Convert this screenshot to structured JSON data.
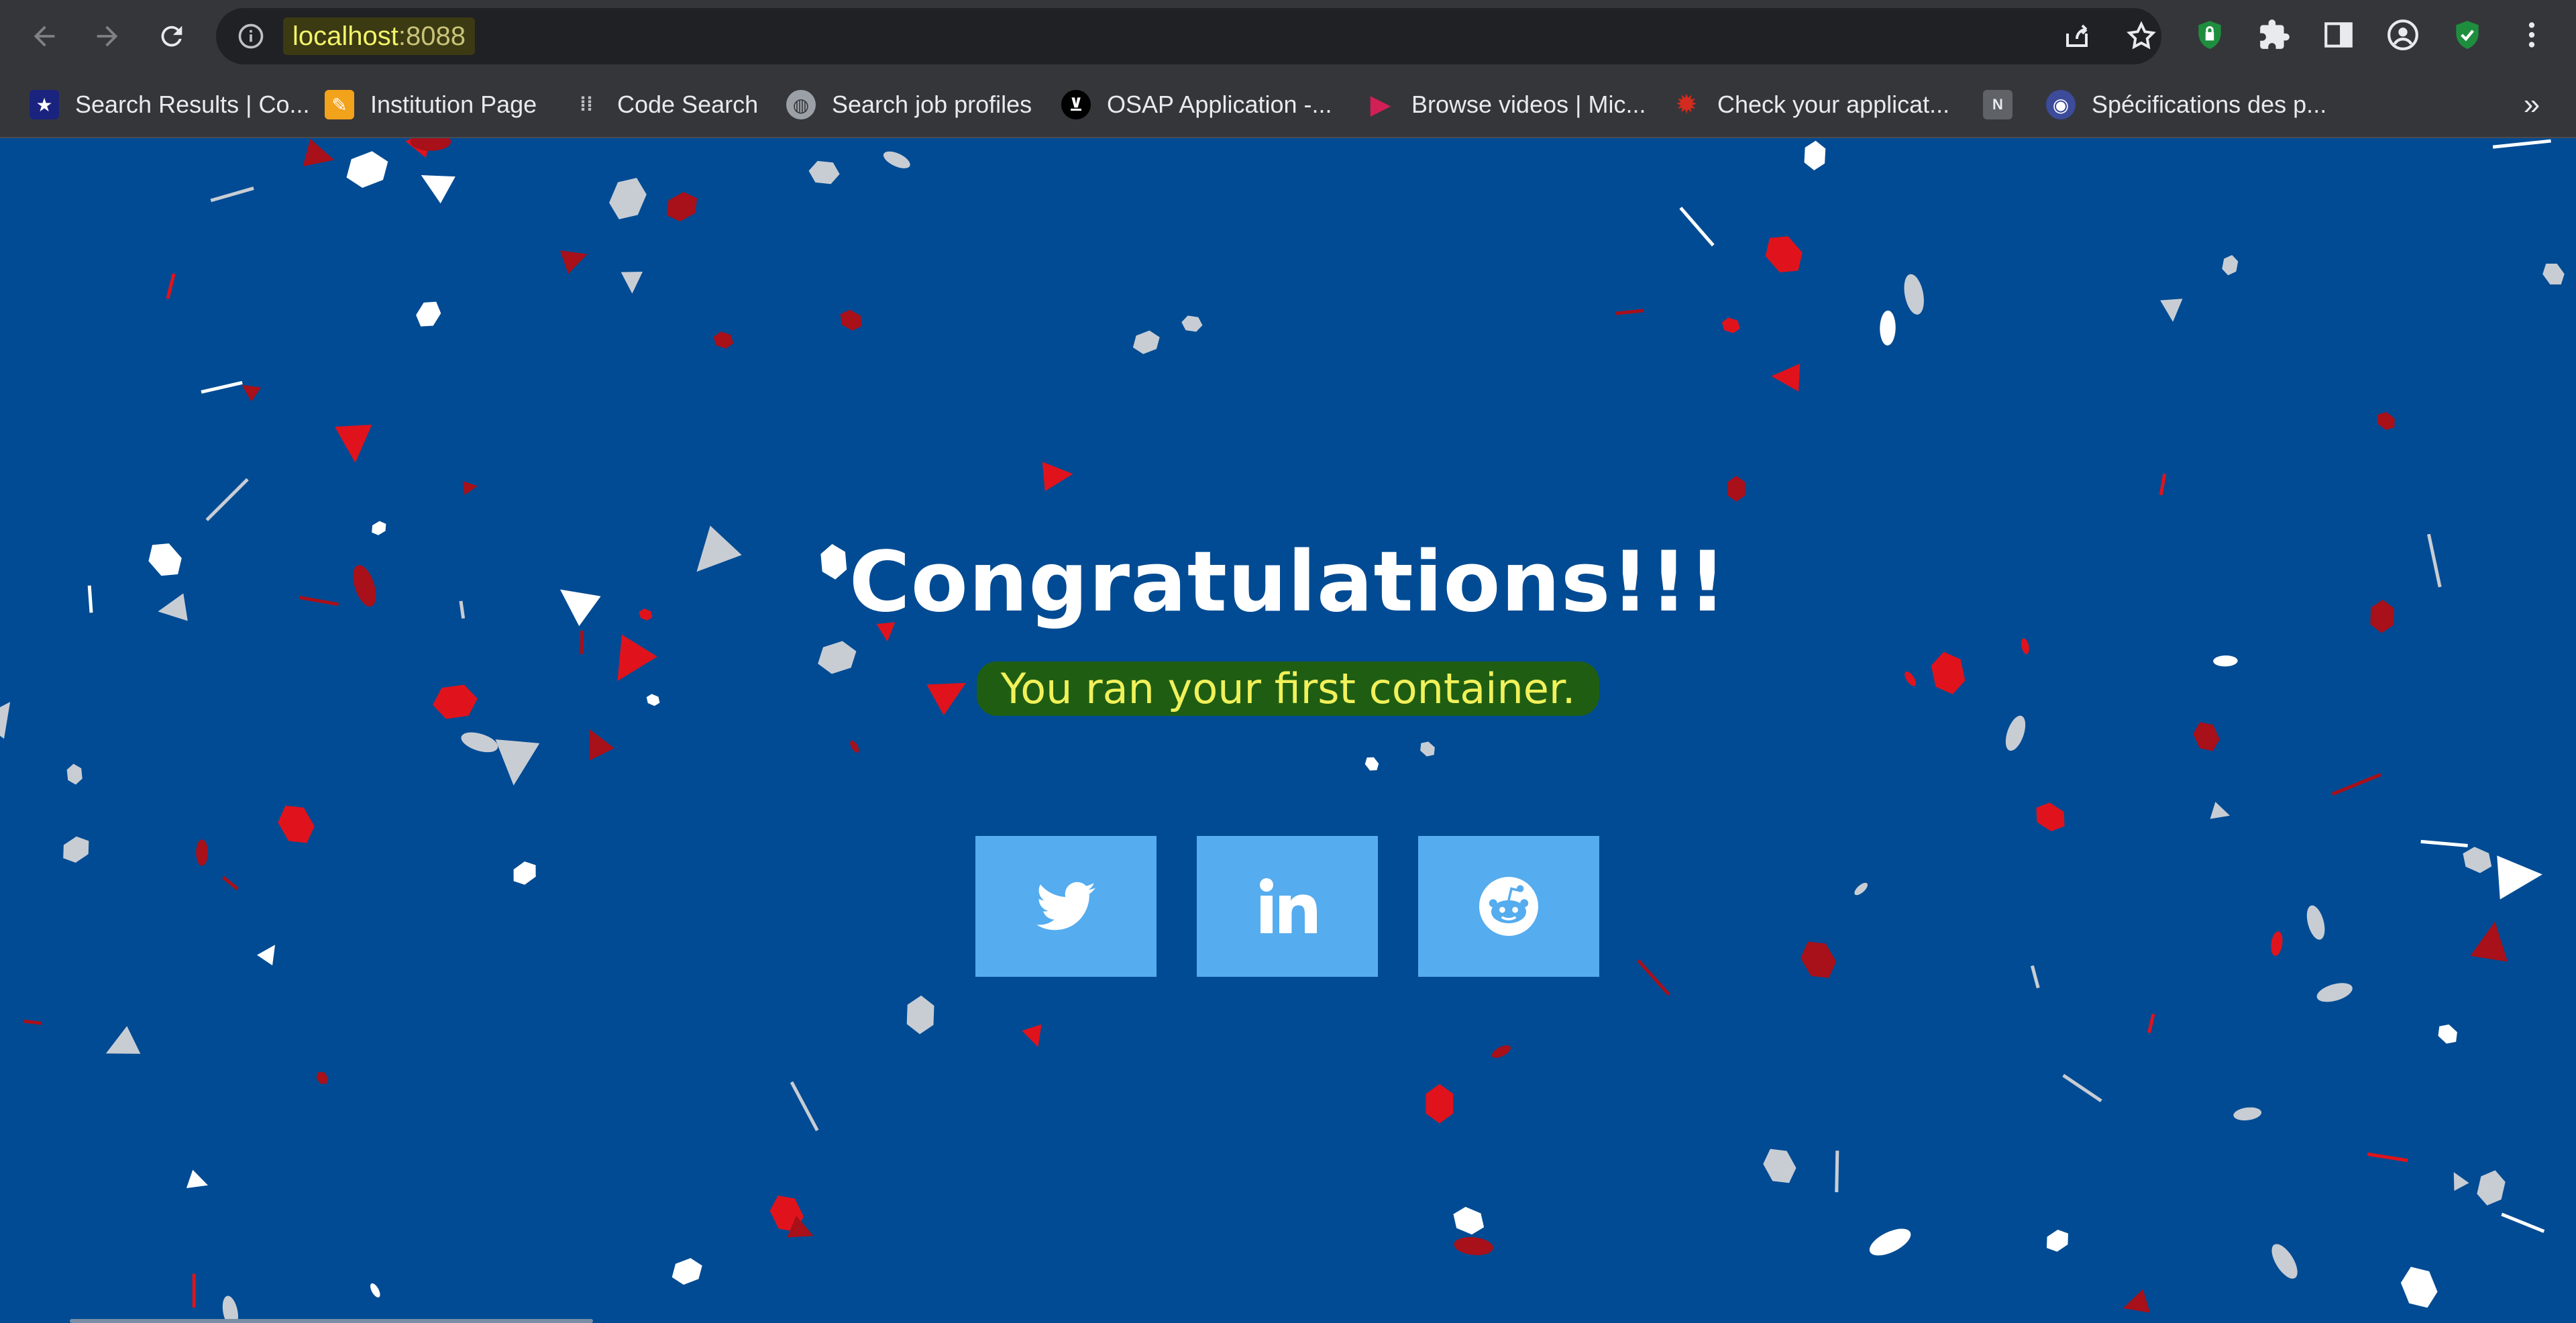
{
  "browser": {
    "url_host": "localhost",
    "url_port": ":8088",
    "bookmarks": [
      {
        "label": "Search Results | Co...",
        "icon": "star-flag-icon",
        "color": "#1a237e"
      },
      {
        "label": "Institution Page",
        "icon": "pencil-icon",
        "color": "#f2a21b"
      },
      {
        "label": "Code Search",
        "icon": "dots-icon",
        "color": "#35363a"
      },
      {
        "label": "Search job profiles",
        "icon": "globe-icon",
        "color": "#9aa0a6"
      },
      {
        "label": "OSAP Application -...",
        "icon": "ontario-logo-icon",
        "color": "#000000"
      },
      {
        "label": "Browse videos | Mic...",
        "icon": "play-icon",
        "color": "#d21f56"
      },
      {
        "label": "Check your applicat...",
        "icon": "maple-leaf-icon",
        "color": "#d52b1e"
      },
      {
        "label": "",
        "icon": "n-icon",
        "color": "#5f6368"
      },
      {
        "label": "Spécifications des p...",
        "icon": "eye-icon",
        "color": "#3c4b9a"
      }
    ]
  },
  "page": {
    "title": "Congratulations!!!",
    "subtitle": "You ran your first container.",
    "share_buttons": [
      {
        "name": "twitter",
        "icon": "twitter-icon"
      },
      {
        "name": "linkedin",
        "icon": "linkedin-icon"
      },
      {
        "name": "reddit",
        "icon": "reddit-icon"
      }
    ],
    "colors": {
      "background": "#004b93",
      "button": "#55acee",
      "confetti": [
        "#ffffff",
        "#c8cdd4",
        "#e0131c",
        "#a8101a"
      ]
    }
  }
}
